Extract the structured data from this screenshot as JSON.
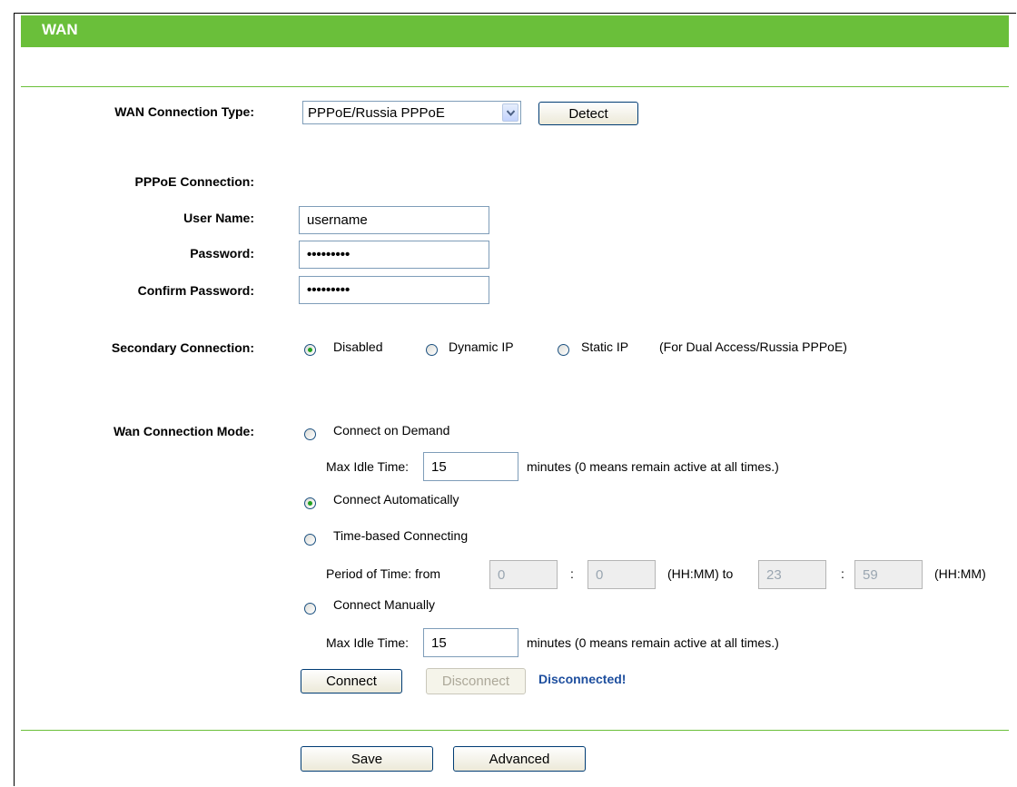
{
  "header": {
    "title": "WAN"
  },
  "connection_type": {
    "label": "WAN Connection Type:",
    "selected": "PPPoE/Russia PPPoE",
    "detect_label": "Detect"
  },
  "pppoe": {
    "section_label": "PPPoE Connection:",
    "username_label": "User Name:",
    "username_value": "username",
    "password_label": "Password:",
    "password_value": "•••••••••",
    "confirm_label": "Confirm Password:",
    "confirm_value": "•••••••••"
  },
  "secondary": {
    "label": "Secondary Connection:",
    "options": [
      "Disabled",
      "Dynamic IP",
      "Static IP"
    ],
    "selected": "Disabled",
    "note": "(For Dual Access/Russia PPPoE)"
  },
  "mode": {
    "label": "Wan Connection Mode:",
    "selected": "Connect Automatically",
    "on_demand": {
      "label": "Connect on Demand",
      "idle_label": "Max Idle Time:",
      "idle_value": "15",
      "idle_note": "minutes (0 means remain active at all times.)"
    },
    "auto": {
      "label": "Connect Automatically"
    },
    "time_based": {
      "label": "Time-based Connecting",
      "period_label": "Period of Time: from",
      "from_hh": "0",
      "sep": ":",
      "from_mm": "0",
      "to_label": "(HH:MM) to",
      "to_hh": "23",
      "to_mm": "59",
      "unit": "(HH:MM)"
    },
    "manual": {
      "label": "Connect Manually",
      "idle_label": "Max Idle Time:",
      "idle_value": "15",
      "idle_note": "minutes (0 means remain active at all times.)"
    }
  },
  "actions": {
    "connect_label": "Connect",
    "disconnect_label": "Disconnect",
    "status": "Disconnected!"
  },
  "footer": {
    "save_label": "Save",
    "advanced_label": "Advanced"
  },
  "colors": {
    "header_green": "#6abf3a",
    "status_blue": "#1d4e9e",
    "radio_dot": "#21a121"
  }
}
